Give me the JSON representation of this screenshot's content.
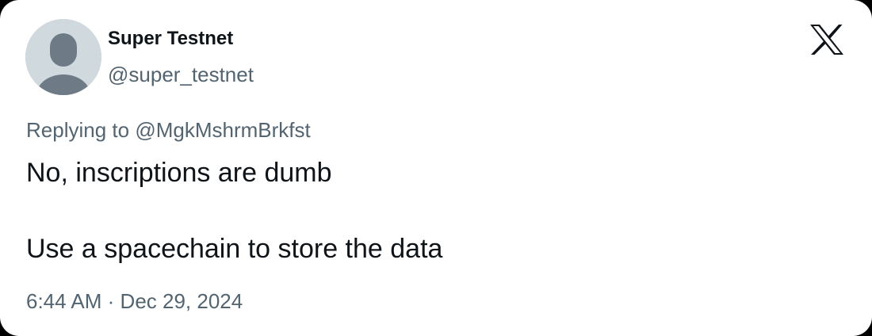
{
  "author": {
    "display_name": "Super Testnet",
    "handle": "@super_testnet",
    "avatar_icon": "default-avatar-icon"
  },
  "brand": {
    "logo_icon": "x-logo-icon"
  },
  "reply": {
    "prefix": "Replying to",
    "mention": "@MgkMshrmBrkfst"
  },
  "tweet": {
    "lines": [
      "No, inscriptions are dumb",
      "Use a spacechain to store the data"
    ],
    "time": "6:44 AM",
    "separator": "·",
    "date": "Dec 29, 2024"
  },
  "colors": {
    "card_background": "#ffffff",
    "frame_background": "#000000",
    "primary_text": "#0f1419",
    "secondary_text": "#536471",
    "avatar_background": "#cfd9de",
    "avatar_figure": "#6e7b87"
  }
}
